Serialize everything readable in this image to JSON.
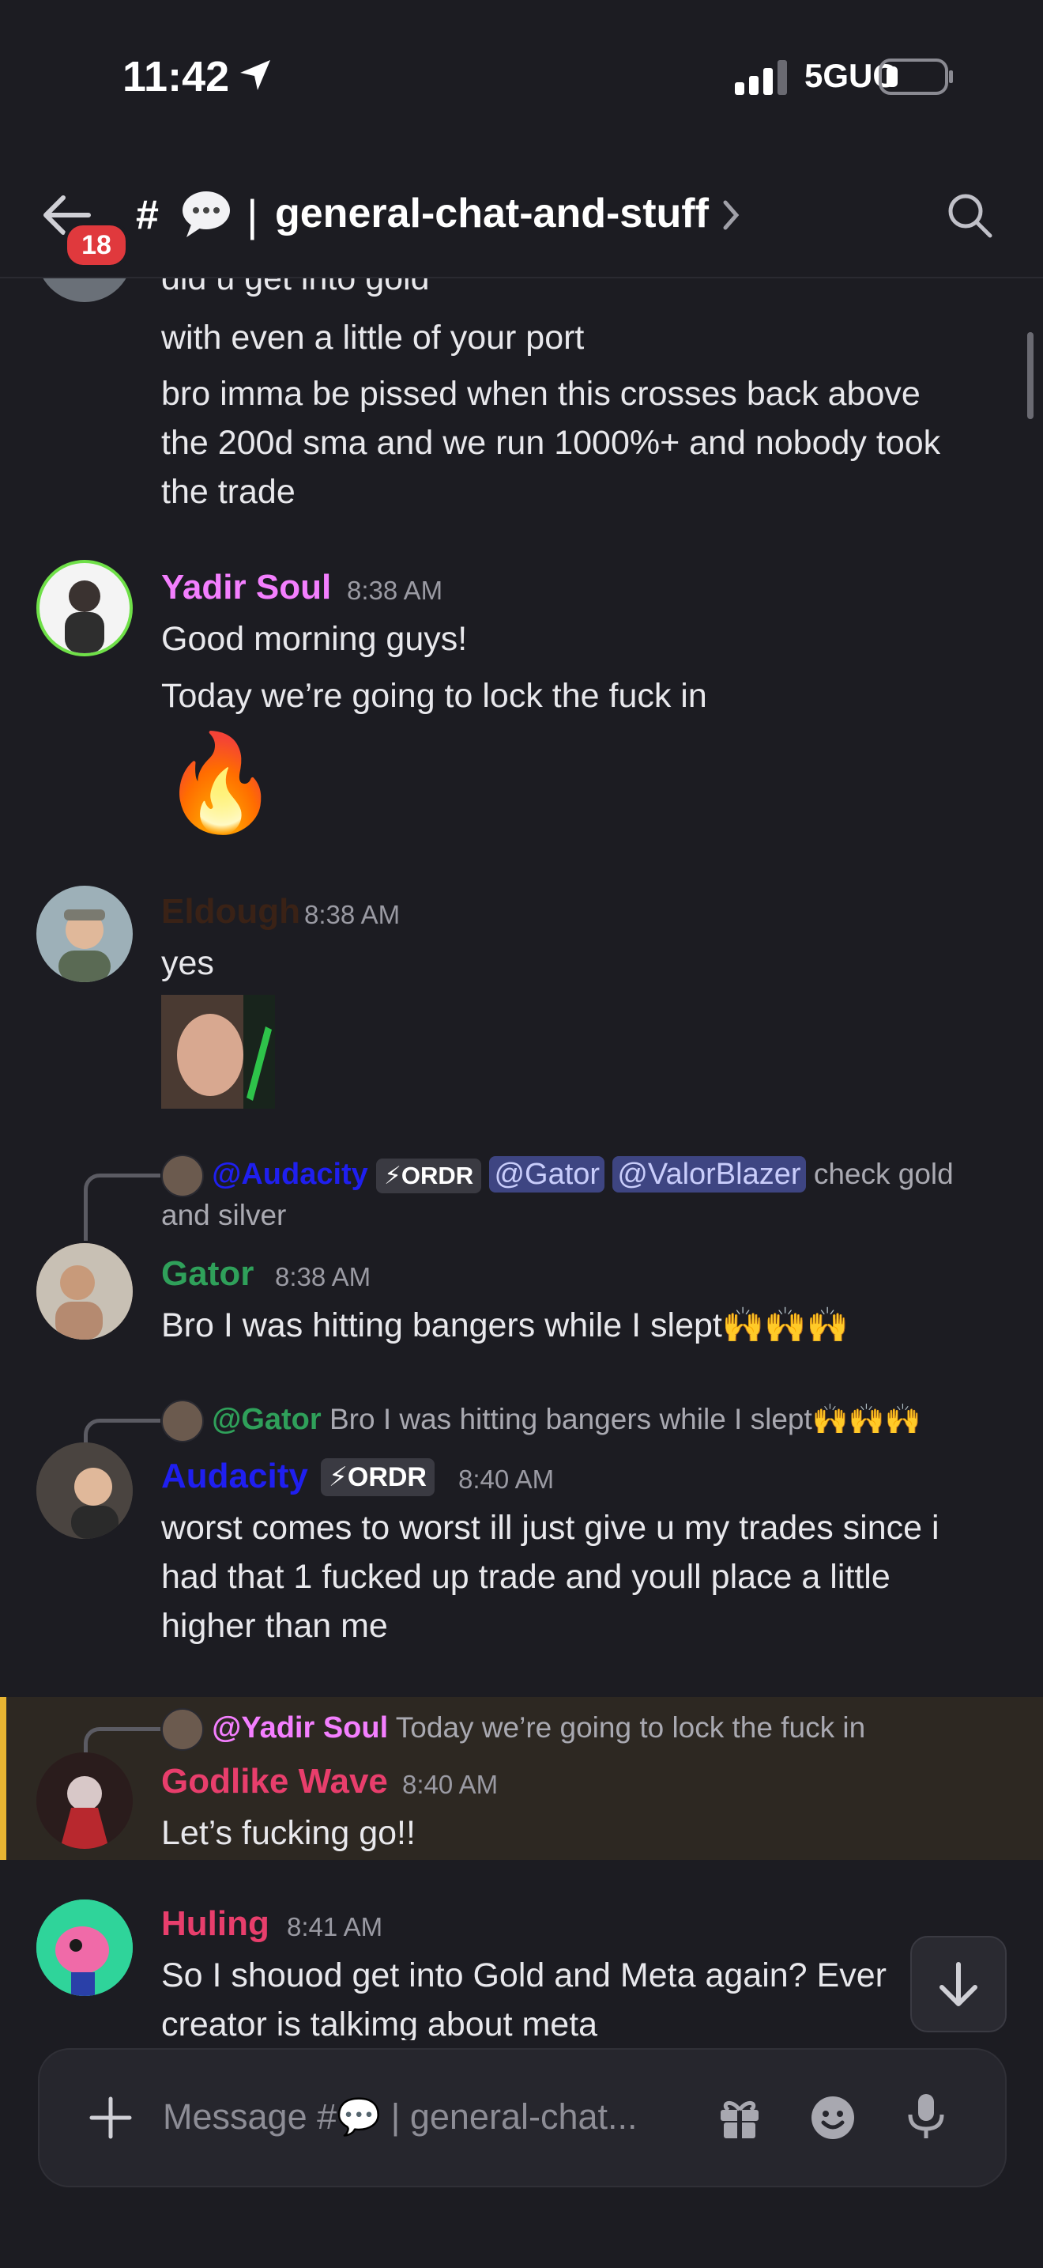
{
  "status_bar": {
    "time": "11:42",
    "network": "5GUC"
  },
  "header": {
    "unread_badge": "18",
    "hash": "#",
    "separator": "|",
    "channel_name": "general-chat-and-stuff"
  },
  "messages": {
    "m0": {
      "cut_line": "did u get into gold",
      "line1": "with even a little of your port",
      "line2": "bro imma be pissed when this crosses back above",
      "line3": "the 200d sma and we run 1000%+ and nobody took",
      "line4": "the trade"
    },
    "m1": {
      "author": "Yadir Soul",
      "author_color": "#f47fff",
      "time": "8:38 AM",
      "line1": "Good morning guys!",
      "line2": "Today we’re going to lock the fuck in",
      "emoji": "🔥"
    },
    "m2": {
      "author": "Eldough",
      "author_color": "#3a2216",
      "time": "8:38 AM",
      "line1": "yes"
    },
    "m3": {
      "reply_mention1": "@Audacity",
      "reply_tag": "⚡ORDR",
      "reply_mention2": "@Gator",
      "reply_mention3": "@ValorBlazer",
      "reply_text1": "check gold",
      "reply_text2": "and silver",
      "author": "Gator",
      "author_color": "#2fa05a",
      "time": "8:38 AM",
      "line1": "Bro I was hitting bangers while I slept🙌🙌🙌"
    },
    "m4": {
      "reply_mention": "@Gator",
      "reply_text": "Bro I was hitting bangers while I slept🙌🙌🙌",
      "author": "Audacity",
      "author_color": "#1f1ff0",
      "tag": "⚡ORDR",
      "time": "8:40 AM",
      "line1": "worst comes to worst ill just give u my trades since i",
      "line2": "had that 1 fucked up trade and youll place a little",
      "line3": "higher than me"
    },
    "m5": {
      "reply_mention": "@Yadir Soul",
      "reply_text": "Today we’re going to lock the fuck in",
      "author": "Godlike Wave",
      "author_color": "#e83e6c",
      "time": "8:40 AM",
      "line1": "Let’s fucking go!!"
    },
    "m6": {
      "author": "Huling",
      "author_color": "#e83e6c",
      "time": "8:41 AM",
      "line1": "So I shouod get into Gold and Meta again? Ever",
      "line2": "creator is talkimg about meta"
    }
  },
  "composer": {
    "placeholder": "Message #💬 | general-chat..."
  },
  "colors": {
    "background": "#1c1c22",
    "highlight_bg": "#2d2822",
    "highlight_bar": "#e8b532",
    "mention_bg": "#3e4582"
  },
  "icons": [
    "back-arrow-icon",
    "chat-bubble-icon",
    "chevron-right-icon",
    "search-icon",
    "add-icon",
    "gift-icon",
    "emoji-icon",
    "mic-icon",
    "arrow-down-icon"
  ]
}
